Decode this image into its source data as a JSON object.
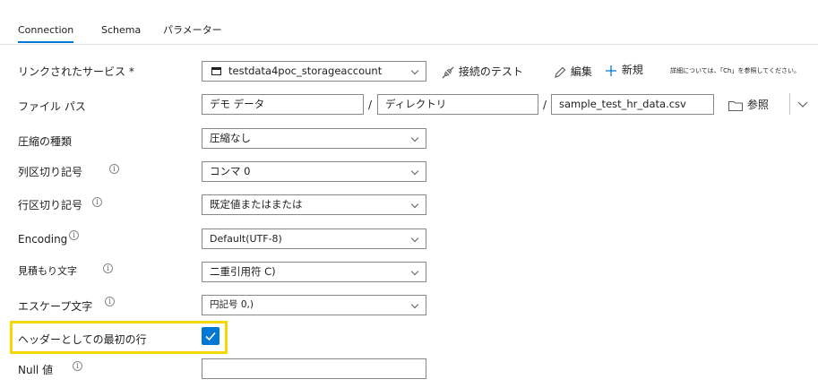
{
  "tabs": [
    "Connection",
    "Schema",
    "パラメーター"
  ],
  "labels": {
    "linked_service": "リンクされたサービス *",
    "file_path": "ファイル パス",
    "compression": "圧縮の種類",
    "column_delimiter": "列区切り記号",
    "row_delimiter": "行区切り記号",
    "encoding": "Encoding",
    "quote_char": "見積もり文字",
    "escape_char": "エスケープ文字",
    "first_row_header": "ヘッダーとしての最初の行",
    "null_value": "Null 値"
  },
  "values": {
    "linked_service": "testdata4poc_storageaccount",
    "path_container": "デモ データ",
    "path_directory": "ディレクトリ",
    "path_file": "sample_test_hr_data.csv",
    "compression": "圧縮なし",
    "column_delimiter": "コンマ 0",
    "row_delimiter": "既定値またはまたは",
    "encoding": "Default(UTF-8)",
    "quote_char": "二重引用符 C)",
    "escape_char": "円記号 0,)",
    "null_value": ""
  },
  "actions": {
    "test_connection": "接続のテスト",
    "edit": "編集",
    "new": "新規",
    "browse": "参照",
    "help_text": "詳細については、「Ch」を参照してください。"
  },
  "path_separator": "/",
  "first_row_header_checked": true,
  "colors": {
    "accent": "#0078d4",
    "highlight": "#f5d800",
    "text": "#201f1e",
    "border": "#8a8886"
  }
}
